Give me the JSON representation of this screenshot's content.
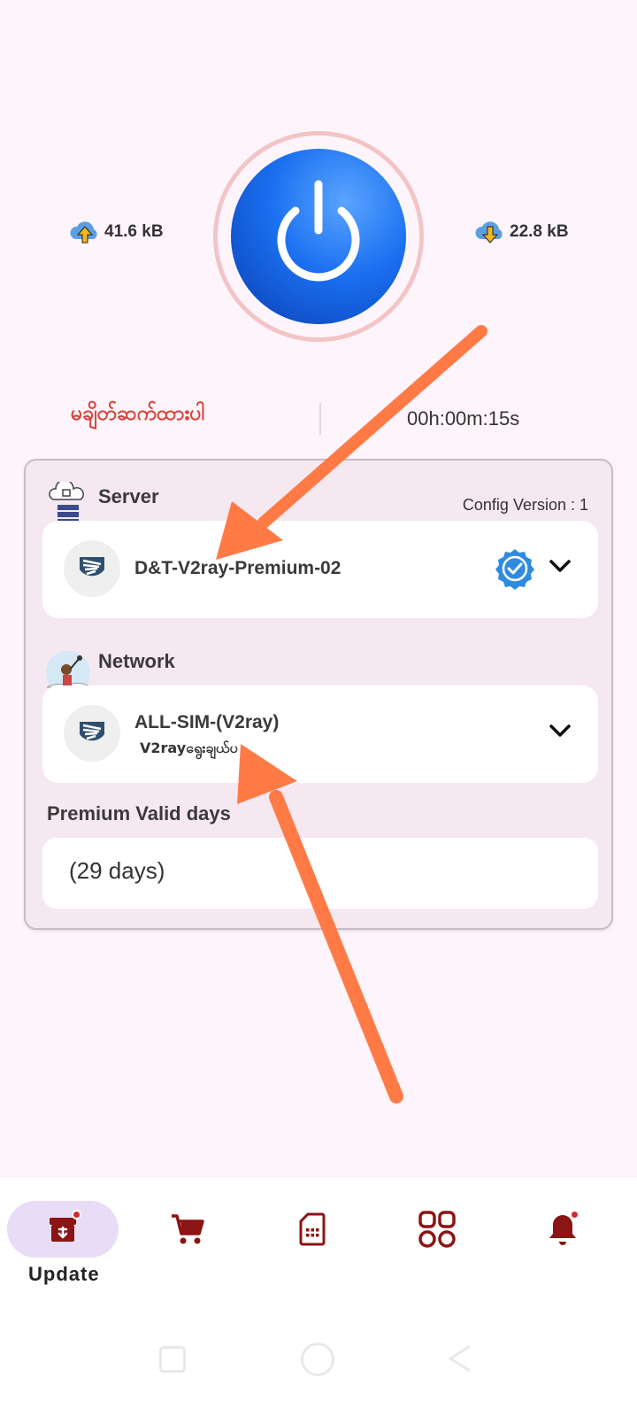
{
  "stats": {
    "upload": "41.6 kB",
    "download": "22.8 kB"
  },
  "status": {
    "text": "မချိတ်ဆက်ထားပါ",
    "timer": "00h:00m:15s"
  },
  "server": {
    "label": "Server",
    "config_version": "Config Version : 1",
    "selected": "D&T-V2ray-Premium-02"
  },
  "network": {
    "label": "Network",
    "selected": "ALL-SIM-(V2ray)",
    "subtitle": "V2rayရွေးချယ်ပ"
  },
  "premium": {
    "label": "Premium Valid days",
    "value": "(29 days)"
  },
  "nav": {
    "items": [
      {
        "label": "Update",
        "icon": "archive-download-icon",
        "active": true
      },
      {
        "icon": "cart-icon"
      },
      {
        "icon": "sim-card-icon"
      },
      {
        "icon": "grid-icon"
      },
      {
        "icon": "bell-icon"
      }
    ]
  },
  "colors": {
    "brand_red": "#8b1414",
    "accent_blue": "#1a6ff0",
    "status_red": "#d9403a",
    "arrow": "#ff7a45"
  }
}
